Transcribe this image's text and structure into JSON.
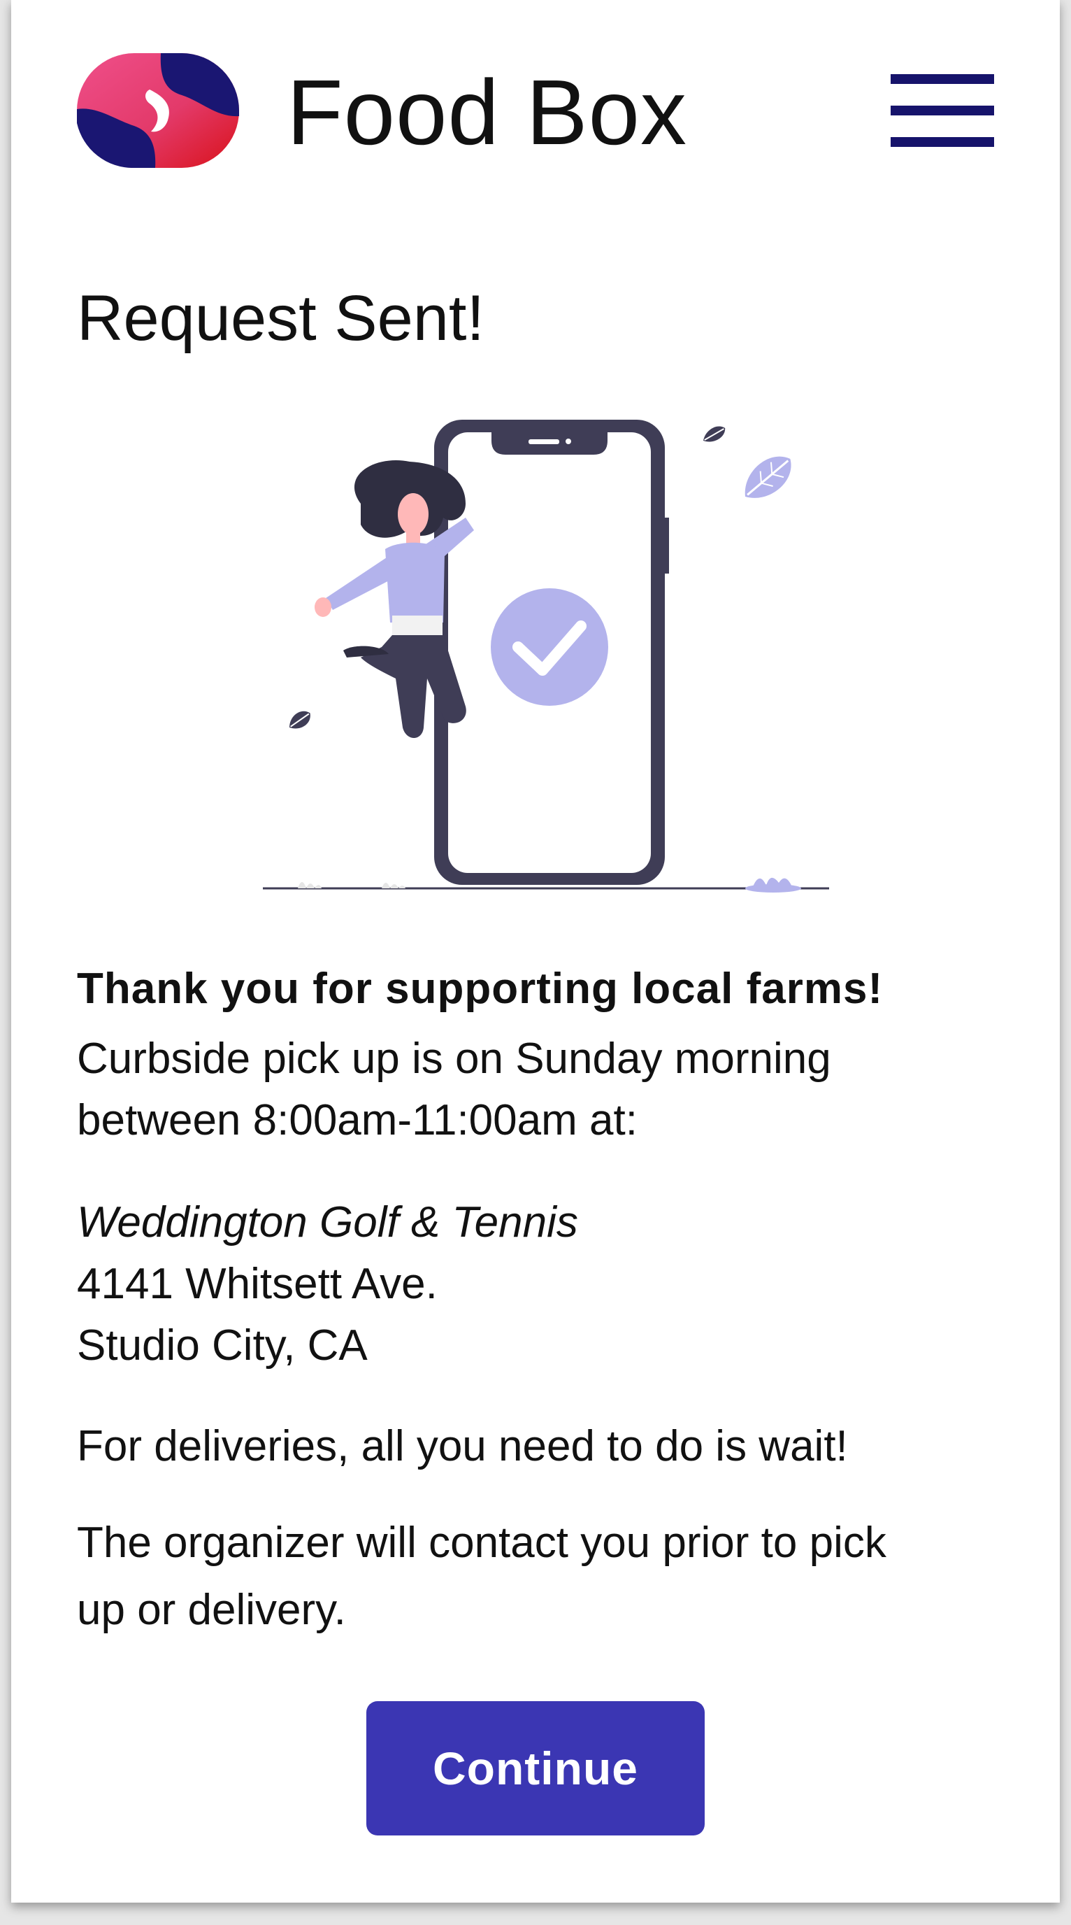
{
  "header": {
    "brand_name": "Food Box",
    "logo_icon": "food-box-logo-icon",
    "menu_icon": "hamburger-menu-icon"
  },
  "page": {
    "title": "Request Sent!",
    "illustration": "woman-jumping-beside-phone-with-checkmark"
  },
  "message": {
    "thanks": "Thank you for supporting local farms!",
    "pickup_line1": "Curbside pick up is on Sunday morning",
    "pickup_line2": "between 8:00am-11:00am at:",
    "venue": "Weddington Golf & Tennis",
    "street": "4141 Whitsett Ave.",
    "city": "Studio City, CA",
    "delivery": "For deliveries, all you need to do is wait!",
    "organizer_line1": "The organizer will contact you prior to pick",
    "organizer_line2": "up or delivery."
  },
  "actions": {
    "continue_label": "Continue"
  },
  "colors": {
    "accent": "#3b36b3",
    "menu_navy": "#16136b",
    "illustration_purple": "#b3b3ec",
    "phone_frame": "#3f3d56",
    "logo_pink": "#e6418a",
    "logo_red": "#e01e1e"
  }
}
